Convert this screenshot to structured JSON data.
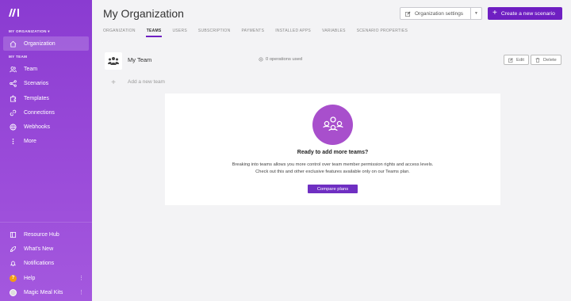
{
  "sidebar": {
    "org_section": "MY ORGANIZATION ▾",
    "org_item": "Organization",
    "team_section": "MY TEAM",
    "team_items": [
      {
        "label": "Team",
        "icon": "users-icon"
      },
      {
        "label": "Scenarios",
        "icon": "share-icon"
      },
      {
        "label": "Templates",
        "icon": "puzzle-icon"
      },
      {
        "label": "Connections",
        "icon": "link-icon"
      },
      {
        "label": "Webhooks",
        "icon": "globe-icon"
      },
      {
        "label": "More",
        "icon": "more-vertical-icon"
      }
    ],
    "bottom_items": [
      {
        "label": "Resource Hub",
        "icon": "book-icon"
      },
      {
        "label": "What's New",
        "icon": "rocket-icon"
      },
      {
        "label": "Notifications",
        "icon": "bell-icon"
      },
      {
        "label": "Help",
        "icon": "help-icon"
      },
      {
        "label": "Magic Meal Kits",
        "icon": "avatar-icon"
      }
    ]
  },
  "header": {
    "title": "My Organization",
    "settings_label": "Organization settings",
    "create_label": "Create a new scenario"
  },
  "tabs": [
    {
      "label": "ORGANIZATION",
      "active": false
    },
    {
      "label": "TEAMS",
      "active": true
    },
    {
      "label": "USERS",
      "active": false
    },
    {
      "label": "SUBSCRIPTION",
      "active": false
    },
    {
      "label": "PAYMENTS",
      "active": false
    },
    {
      "label": "INSTALLED APPS",
      "active": false
    },
    {
      "label": "VARIABLES",
      "active": false
    },
    {
      "label": "SCENARIO PROPERTIES",
      "active": false
    }
  ],
  "team": {
    "name": "My Team",
    "operations": "0 operations used",
    "edit_label": "Edit",
    "delete_label": "Delete",
    "add_label": "Add a new team"
  },
  "promo": {
    "title": "Ready to add more teams?",
    "line1": "Breaking into teams allows you more control over team member permission rights and access levels.",
    "line2": "Check out this and other exclusive features available only on our Teams plan.",
    "button": "Compare plans"
  },
  "colors": {
    "brand": "#6f1fc2",
    "sidebar_top": "#8a3bd1",
    "promo_circle": "#a84fcc"
  }
}
